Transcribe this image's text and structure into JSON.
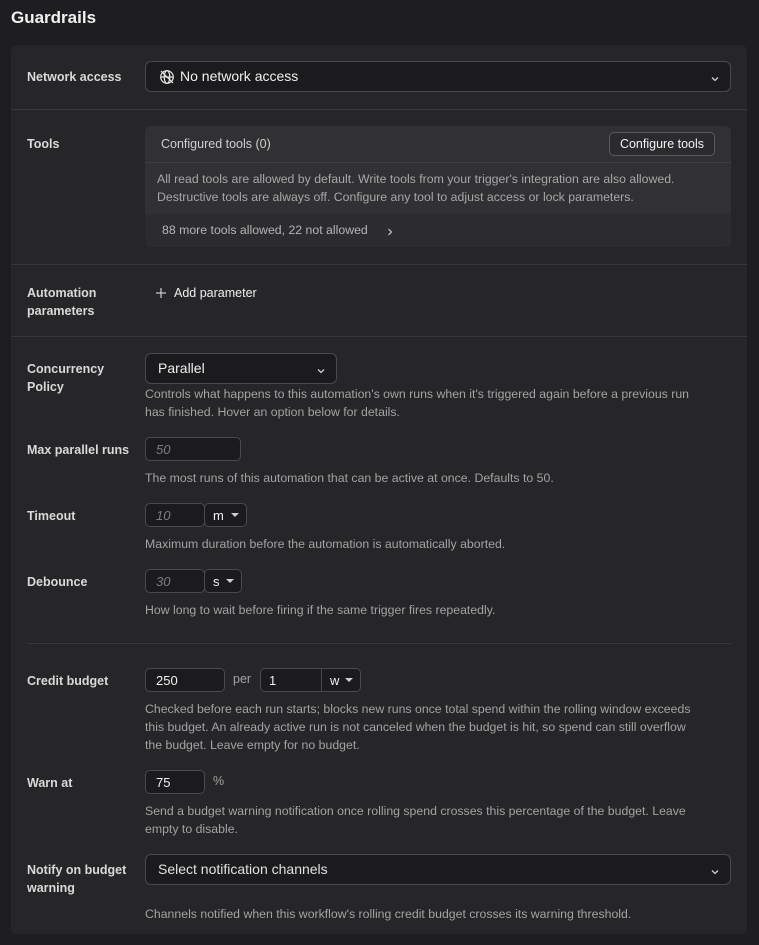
{
  "page": {
    "title": "Guardrails"
  },
  "network": {
    "label": "Network access",
    "value": "No network access"
  },
  "tools": {
    "label": "Tools",
    "configured": "Configured tools (0)",
    "configure_button": "Configure tools",
    "description_line1": "All read tools are allowed by default. Write tools from your trigger's integration are also allowed.",
    "description_line2": "Destructive tools are always off. Configure any tool to adjust access or lock parameters.",
    "summary": "88 more tools allowed, 22 not allowed"
  },
  "automation": {
    "label_line1": "Automation",
    "label_line2": "parameters",
    "add_label": "Add parameter"
  },
  "concurrency": {
    "label_line1": "Concurrency",
    "label_line2": "Policy",
    "value": "Parallel",
    "help_line1": "Controls what happens to this automation's own runs when it's triggered again before a previous run",
    "help_line2": "has finished. Hover an option below for details."
  },
  "max_parallel": {
    "label": "Max parallel runs",
    "placeholder": "50",
    "help": "The most runs of this automation that can be active at once. Defaults to 50."
  },
  "timeout": {
    "label": "Timeout",
    "placeholder": "10",
    "unit": "m",
    "help": "Maximum duration before the automation is automatically aborted."
  },
  "debounce": {
    "label": "Debounce",
    "placeholder": "30",
    "unit": "s",
    "help": "How long to wait before firing if the same trigger fires repeatedly."
  },
  "credit_budget": {
    "label": "Credit budget",
    "value": "250",
    "per": "per",
    "window_value": "1",
    "window_unit": "w",
    "help_line1": "Checked before each run starts; blocks new runs once total spend within the rolling window exceeds",
    "help_line2": "this budget. An already active run is not canceled when the budget is hit, so spend can still overflow",
    "help_line3": "the budget. Leave empty for no budget."
  },
  "warn_at": {
    "label": "Warn at",
    "value": "75",
    "suffix": "%",
    "help_line1": "Send a budget warning notification once rolling spend crosses this percentage of the budget. Leave",
    "help_line2": "empty to disable."
  },
  "notify": {
    "label_line1": "Notify on budget",
    "label_line2": "warning",
    "placeholder": "Select notification channels",
    "help": "Channels notified when this workflow's rolling credit budget crosses its warning threshold."
  }
}
